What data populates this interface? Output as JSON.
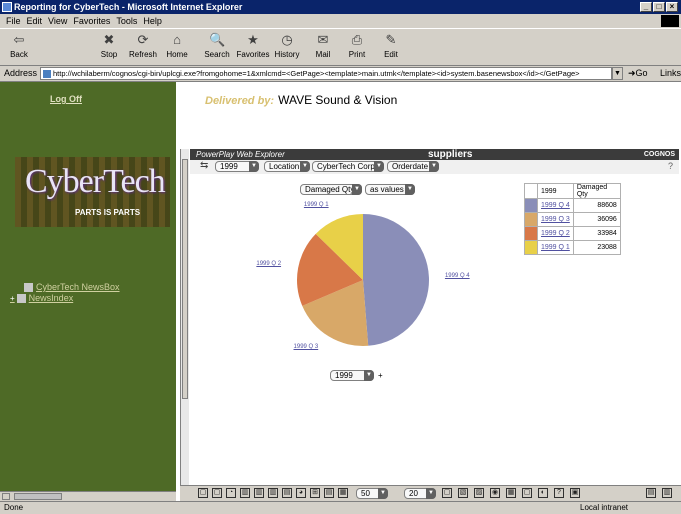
{
  "window": {
    "title": "Reporting for CyberTech - Microsoft Internet Explorer"
  },
  "menu": [
    "File",
    "Edit",
    "View",
    "Favorites",
    "Tools",
    "Help"
  ],
  "toolbar": [
    "Back",
    "Stop",
    "Refresh",
    "Home",
    "Search",
    "Favorites",
    "History",
    "Mail",
    "Print",
    "Edit"
  ],
  "address": {
    "label": "Address",
    "url": "http://wchilaberm/cognos/cgi-bin/uplcgi.exe?fromgohome=1&xmlcmd=<GetPage><template>main.utmk</template><id>system.basenewsbox</id></GetPage>",
    "go": "Go",
    "links": "Links"
  },
  "left": {
    "logoff": "Log Off",
    "banner_name": "CyberTech",
    "banner_tag": "PARTS IS PARTS",
    "nav": [
      "CyberTech NewsBox",
      "NewsIndex"
    ]
  },
  "delivered": {
    "prefix": "Delivered by:",
    "company": "WAVE Sound & Vision"
  },
  "pp": {
    "app": "PowerPlay Web Explorer",
    "title": "suppliers",
    "brand": "COGNOS",
    "dims": [
      "1999",
      "Location",
      "CyberTech Corp.",
      "Orderdate"
    ],
    "measure": "Damaged Qty",
    "mode": "as values",
    "bottom_year": "1999",
    "page_size_1": "50",
    "page_size_2": "20"
  },
  "chart_data": {
    "type": "pie",
    "header_category": "1999",
    "header_measure": "Damaged Qty",
    "categories": [
      "1999 Q 4",
      "1999 Q 3",
      "1999 Q 2",
      "1999 Q 1"
    ],
    "values": [
      88608,
      36096,
      33984,
      23088
    ],
    "colors": [
      "#8a8eb8",
      "#d8a868",
      "#d87848",
      "#e8d048"
    ]
  },
  "status": {
    "left": "Done",
    "right": "Local intranet"
  }
}
